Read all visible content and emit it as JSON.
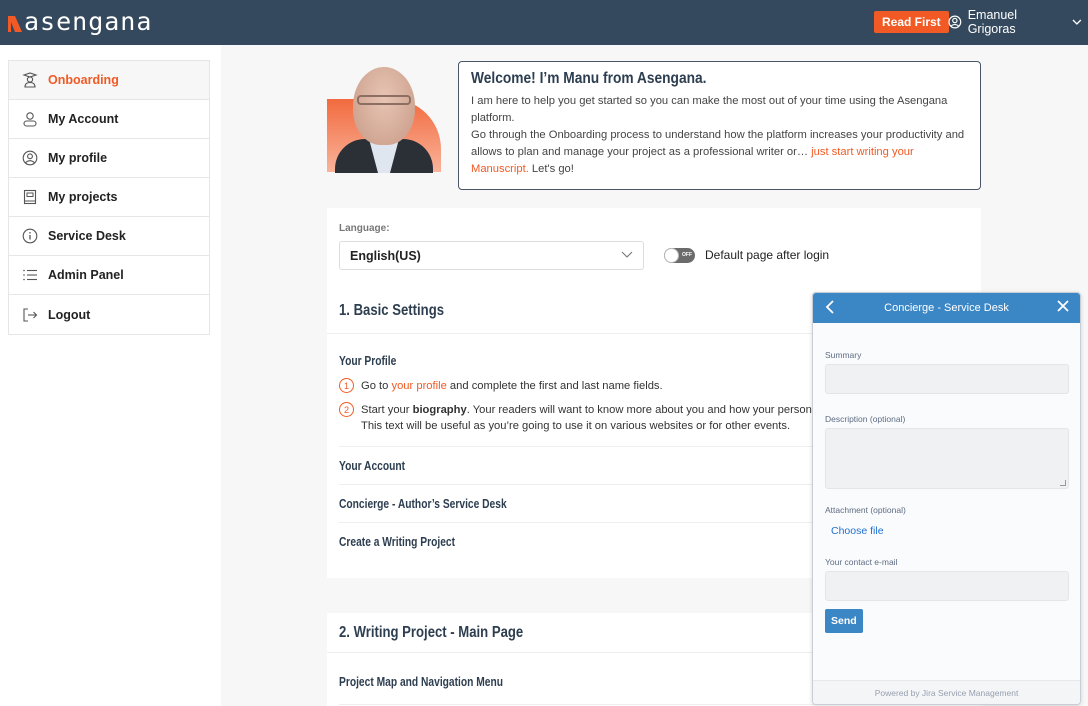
{
  "header": {
    "logo_text": "asengana",
    "read_first_label": "Read First",
    "user_name": "Emanuel Grigoras",
    "brand_color": "#f15a24",
    "bar_color": "#34495e"
  },
  "sidebar": {
    "items": [
      {
        "label": "Onboarding",
        "icon": "graduate-icon",
        "active": true
      },
      {
        "label": "My Account",
        "icon": "user-icon",
        "active": false
      },
      {
        "label": "My profile",
        "icon": "user-circle-icon",
        "active": false
      },
      {
        "label": "My projects",
        "icon": "book-icon",
        "active": false
      },
      {
        "label": "Service Desk",
        "icon": "info-icon",
        "active": false
      },
      {
        "label": "Admin Panel",
        "icon": "list-icon",
        "active": false
      },
      {
        "label": "Logout",
        "icon": "logout-icon",
        "active": false
      }
    ]
  },
  "welcome": {
    "title": "Welcome! I’m Manu from Asengana.",
    "paragraph1": "I am here to help you get started so you can make the most out of your time using the Asengana platform.",
    "paragraph2_start": "Go through the Onboarding process to understand how the platform increases your productivity and allows to plan and manage your project as a professional writer or… ",
    "paragraph2_link": "just start writing your Manuscript.",
    "paragraph2_end": " Let's go!"
  },
  "settings": {
    "language_label": "Language:",
    "language_value": "English(US)",
    "toggle_state": "OFF",
    "toggle_label": "Default page after login"
  },
  "section1": {
    "title": "1. Basic Settings",
    "profile_title": "Your Profile",
    "steps": [
      {
        "num": "1",
        "pre": "Go to ",
        "link": "your profile",
        "post": " and complete the first and last name fields."
      },
      {
        "num": "2",
        "pre": "Start your ",
        "bold": "biography",
        "post": ". Your readers will want to know more about you and how your personal",
        "line2": "This text will be useful as you’re going to use it on various websites or for other events."
      }
    ],
    "rows": [
      "Your Account",
      "Concierge - Author’s Service Desk",
      "Create a Writing Project"
    ]
  },
  "section2": {
    "title": "2. Writing Project - Main Page",
    "rows": [
      "Project Map and Navigation Menu"
    ]
  },
  "widget": {
    "title": "Concierge - Service Desk",
    "summary_label": "Summary",
    "summary_value": "",
    "description_label": "Description (optional)",
    "description_value": "",
    "attachment_label": "Attachment (optional)",
    "choose_file_label": "Choose file",
    "email_label": "Your contact e-mail",
    "email_value": "",
    "send_label": "Send",
    "footer": "Powered by Jira Service Management",
    "accent_color": "#3b86c4"
  }
}
